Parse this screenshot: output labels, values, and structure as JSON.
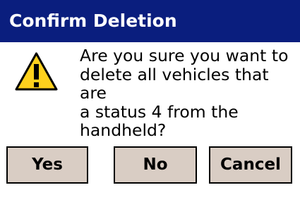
{
  "dialog": {
    "title": "Confirm Deletion",
    "message": "Are you sure you want to\ndelete all vehicles that are\na status 4 from the\nhandheld?",
    "icon": "warning-icon",
    "buttons": {
      "yes": "Yes",
      "no": "No",
      "cancel": "Cancel"
    }
  },
  "colors": {
    "title_bar": "#0a1e7e",
    "title_text": "#ffffff",
    "button_face": "#d9cdc4",
    "warning_fill": "#fed11d"
  }
}
